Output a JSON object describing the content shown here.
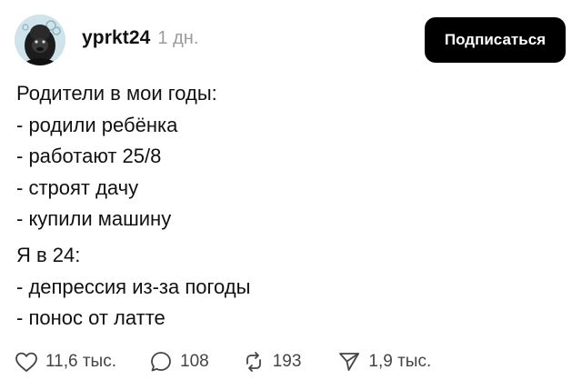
{
  "post": {
    "author": {
      "username": "yprkt24",
      "time": "1 дн.",
      "avatar_icon": "gorilla-avatar"
    },
    "follow_label": "Подписаться",
    "text_block_1": [
      "Родители в мои годы:",
      "- родили ребёнка",
      "- работают 25/8",
      "- строят дачу",
      "- купили машину"
    ],
    "text_block_2": [
      "Я в 24:",
      "- депрессия из-за погоды",
      "- понос от латте"
    ],
    "actions": {
      "likes": "11,6 тыс.",
      "comments": "108",
      "reposts": "193",
      "shares": "1,9 тыс."
    }
  },
  "colors": {
    "text": "#111111",
    "muted": "#9b9b9b",
    "button_bg": "#000000",
    "button_text": "#ffffff",
    "icon": "#444444"
  }
}
